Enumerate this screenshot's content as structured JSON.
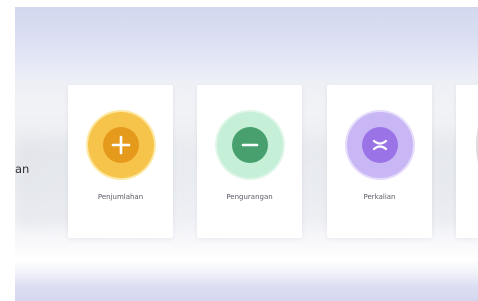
{
  "side_label": "an",
  "cards": [
    {
      "label": "Penjumlahan",
      "icon": "plus-icon",
      "color": "#e59a1c"
    },
    {
      "label": "Pengurangan",
      "icon": "minus-icon",
      "color": "#47a06e"
    },
    {
      "label": "Perkalian",
      "icon": "times-icon",
      "color": "#9a74e6"
    }
  ]
}
